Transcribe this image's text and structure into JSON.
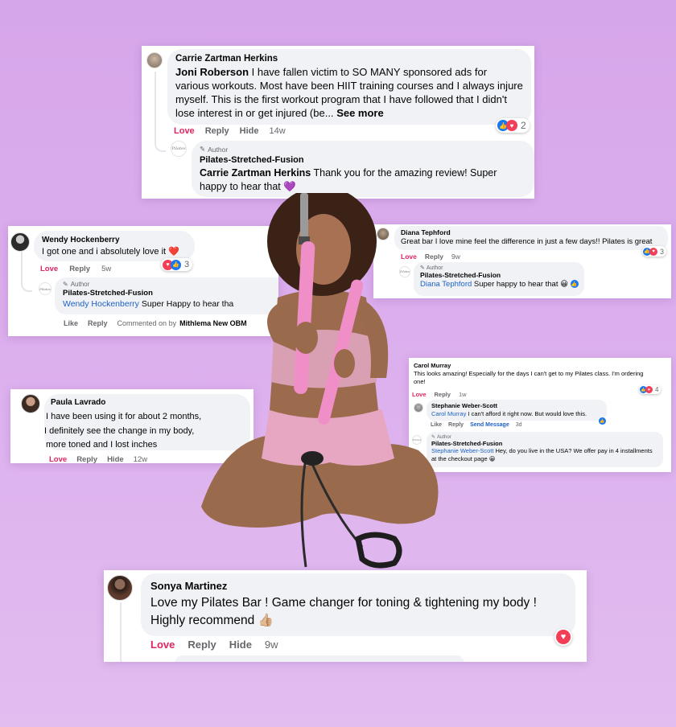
{
  "card1": {
    "name": "Carrie Zartman Herkins",
    "mention": "Joni Roberson",
    "text": " I have fallen victim to SO MANY sponsored ads for various workouts. Most have been HIIT training courses and I always injure myself. This is the first workout program that I have followed that I didn't lose interest in or get injured (be...",
    "see_more": "See more",
    "love": "Love",
    "reply": "Reply",
    "hide": "Hide",
    "time": "14w",
    "reaction_count": "2",
    "author_badge": "Author",
    "reply_name": "Pilates-Stretched-Fusion",
    "reply_mention": "Carrie Zartman Herkins",
    "reply_text": " Thank you for the amazing review! Super happy to hear that 💜"
  },
  "card2": {
    "name": "Wendy Hockenberry",
    "text": "I got one and i absolutely love it ❤️",
    "reaction_count": "3",
    "love": "Love",
    "reply": "Reply",
    "time": "5w",
    "author_badge": "Author",
    "reply_name": "Pilates-Stretched-Fusion",
    "reply_mention": "Wendy Hockenberry",
    "reply_text": " Super Happy to hear tha",
    "like": "Like",
    "reply2": "Reply",
    "commented_on": "Commented on by",
    "commenter": "Mithlema New OBM"
  },
  "card3": {
    "name": "Diana Tephford",
    "text": "Great bar I love mine feel the difference in just a few days!! Pilates is great",
    "love": "Love",
    "reply": "Reply",
    "time": "9w",
    "reaction_count": "3",
    "author_badge": "Author",
    "reply_name": "Pilates-Stretched-Fusion",
    "reply_mention": "Diana Tephford",
    "reply_text": " Super happy to hear that 😀"
  },
  "card4": {
    "name": "Carol Murray",
    "text": "This looks amazing! Especially for the days I can't get to my Pilates class. I'm ordering one!",
    "love": "Love",
    "reply": "Reply",
    "time": "1w",
    "reaction_count": "4",
    "sub_name": "Stephanie Weber-Scott",
    "sub_mention": "Carol Murray",
    "sub_text": " I can't afford it right now. But would love this.",
    "sub_like": "Like",
    "sub_reply": "Reply",
    "sub_send": "Send Message",
    "sub_time": "3d",
    "author_badge": "Author",
    "reply_name": "Pilates-Stretched-Fusion",
    "reply_mention": "Stephanie Weber-Scott",
    "reply_text": " Hey, do you live in the USA? We offer pay in 4 installments at the checkout page 😀"
  },
  "card5": {
    "name": "Paula Lavrado",
    "line1": " I have been using it for about 2 months,",
    "line2": "I definitely see the change in my body,",
    "line3": "more toned and I lost inches",
    "love": "Love",
    "reply": "Reply",
    "hide": "Hide",
    "time": "12w"
  },
  "card6": {
    "name": "Sonya Martinez",
    "text": "Love my Pilates Bar ! Game changer for toning & tightening my body ! Highly recommend 👍🏼",
    "love": "Love",
    "reply": "Reply",
    "hide": "Hide",
    "time": "9w"
  },
  "logo_text": "Pilates",
  "colors": {
    "background": "#d9a9ec",
    "bubble": "#f0f2f5",
    "love": "#e0245e",
    "link": "#1c62c7",
    "like_icon": "#1877f2",
    "heart_icon": "#f33e58",
    "bar_pink": "#f08ec8"
  }
}
